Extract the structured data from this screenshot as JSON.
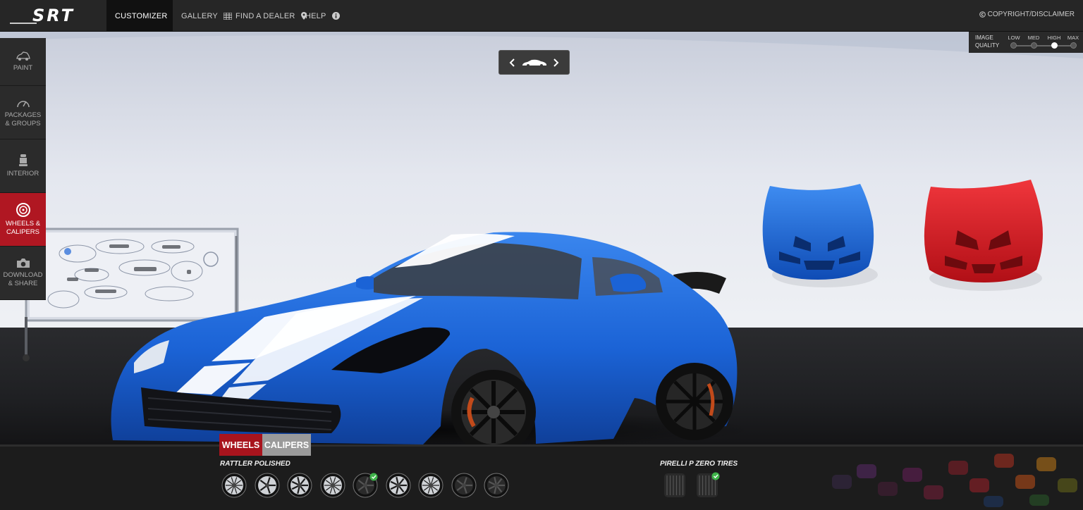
{
  "brand": {
    "logo_text": "SRT"
  },
  "nav": {
    "customizer": "CUSTOMIZER",
    "gallery": "GALLERY",
    "find_dealer": "FIND A DEALER",
    "help": "HELP",
    "copyright": "COPYRIGHT/DISCLAIMER"
  },
  "sidebar": {
    "items": [
      {
        "line1": "PAINT",
        "line2": ""
      },
      {
        "line1": "PACKAGES",
        "line2": "& GROUPS"
      },
      {
        "line1": "INTERIOR",
        "line2": ""
      },
      {
        "line1": "WHEELS &",
        "line2": "CALIPERS"
      },
      {
        "line1": "DOWNLOAD",
        "line2": "& SHARE"
      }
    ],
    "active": "WHEELS & CALIPERS"
  },
  "image_quality": {
    "label_line1": "IMAGE",
    "label_line2": "QUALITY",
    "options": [
      "LOW",
      "MED",
      "HIGH",
      "MAX"
    ],
    "selected": "HIGH"
  },
  "bottom": {
    "tabs": {
      "wheels": "WHEELS",
      "calipers": "CALIPERS"
    },
    "active_tab": "WHEELS",
    "wheels_title": "RATTLER POLISHED",
    "wheel_count": 9,
    "wheel_selected_index": 4,
    "tires_title": "PIRELLI P ZERO TIRES",
    "tire_count": 2,
    "tire_selected_index": 1
  },
  "colors": {
    "accent_red": "#b01722",
    "car_blue": "#1b63d6",
    "hood_red": "#d2161e",
    "check_green": "#3fb44a"
  },
  "icons": [
    "gear-icon",
    "gallery-grid-icon",
    "map-pin-icon",
    "info-icon",
    "copyright-icon",
    "paint-car-icon",
    "speedometer-icon",
    "seat-icon",
    "wheel-icon",
    "camera-icon",
    "chevron-left-icon",
    "chevron-right-icon",
    "car-silhouette-icon",
    "checkmark-icon"
  ]
}
